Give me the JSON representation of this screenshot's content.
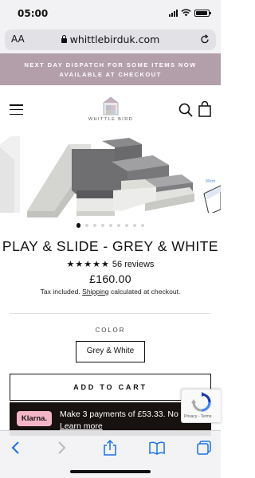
{
  "status_bar": {
    "time": "05:00",
    "battery_level": 0.9
  },
  "browser": {
    "aa_label": "AA",
    "url": "whittlebirduk.com",
    "reload_icon": "reload-icon"
  },
  "announcement": {
    "line1": "NEXT DAY DISPATCH FOR SOME ITEMS NOW",
    "line2": "AVAILABLE AT CHECKOUT"
  },
  "header": {
    "logo_text": "WHITTLE BIRD",
    "menu_icon": "hamburger-icon",
    "search_icon": "search-icon",
    "cart_icon": "shopping-bag-icon"
  },
  "gallery": {
    "slide_count": 9,
    "active_slide": 1
  },
  "product": {
    "title": "PLAY & SLIDE - GREY & WHITE",
    "rating_stars": 5,
    "reviews": "56 reviews",
    "price": "£160.00",
    "tax_prefix": "Tax included.",
    "shipping_link": "Shipping",
    "tax_suffix": "calculated at checkout."
  },
  "options": {
    "label": "COLOR",
    "selected": "Grey & White"
  },
  "actions": {
    "add_to_cart": "ADD TO CART"
  },
  "klarna": {
    "badge": "Klarna.",
    "text": "Make 3 payments of £53.33. No fees.",
    "link": "Learn more"
  },
  "recaptcha": {
    "terms": "Privacy - Terms"
  },
  "colors": {
    "announcement_bg": "#b39fa9",
    "klarna_bg": "#17120f",
    "klarna_badge": "#f5b5c9",
    "ios_blue": "#1a73e8"
  }
}
